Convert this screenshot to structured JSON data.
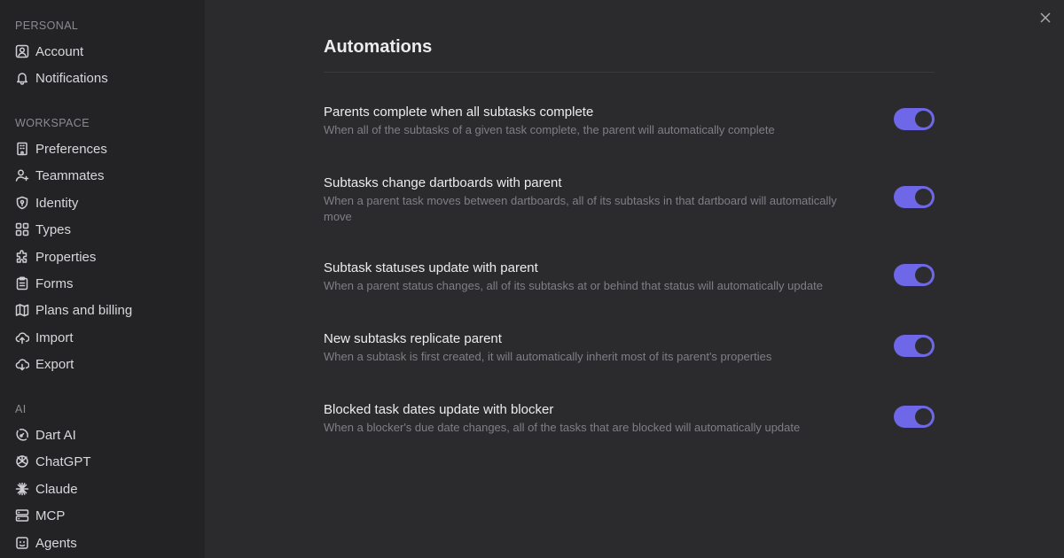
{
  "sidebar": {
    "sections": [
      {
        "title": "PERSONAL",
        "items": [
          {
            "label": "Account",
            "icon": "user-square-icon"
          },
          {
            "label": "Notifications",
            "icon": "bell-icon"
          }
        ]
      },
      {
        "title": "WORKSPACE",
        "items": [
          {
            "label": "Preferences",
            "icon": "building-icon"
          },
          {
            "label": "Teammates",
            "icon": "user-plus-icon"
          },
          {
            "label": "Identity",
            "icon": "shield-icon"
          },
          {
            "label": "Types",
            "icon": "grid-icon"
          },
          {
            "label": "Properties",
            "icon": "puzzle-icon"
          },
          {
            "label": "Forms",
            "icon": "clipboard-icon"
          },
          {
            "label": "Plans and billing",
            "icon": "map-icon"
          },
          {
            "label": "Import",
            "icon": "cloud-upload-icon"
          },
          {
            "label": "Export",
            "icon": "cloud-download-icon"
          }
        ]
      },
      {
        "title": "AI",
        "items": [
          {
            "label": "Dart AI",
            "icon": "dart-icon"
          },
          {
            "label": "ChatGPT",
            "icon": "openai-icon"
          },
          {
            "label": "Claude",
            "icon": "claude-icon"
          },
          {
            "label": "MCP",
            "icon": "server-icon"
          },
          {
            "label": "Agents",
            "icon": "agent-icon"
          }
        ]
      }
    ]
  },
  "main": {
    "title": "Automations",
    "settings": [
      {
        "label": "Parents complete when all subtasks complete",
        "description": "When all of the subtasks of a given task complete, the parent will automatically complete",
        "enabled": true
      },
      {
        "label": "Subtasks change dartboards with parent",
        "description": "When a parent task moves between dartboards, all of its subtasks in that dartboard will automatically move",
        "enabled": true
      },
      {
        "label": "Subtask statuses update with parent",
        "description": "When a parent status changes, all of its subtasks at or behind that status will automatically update",
        "enabled": true
      },
      {
        "label": "New subtasks replicate parent",
        "description": "When a subtask is first created, it will automatically inherit most of its parent's properties",
        "enabled": true
      },
      {
        "label": "Blocked task dates update with blocker",
        "description": "When a blocker's due date changes, all of the tasks that are blocked will automatically update",
        "enabled": true
      }
    ]
  },
  "colors": {
    "accent": "#6e67e8",
    "sidebar_bg": "#232325",
    "main_bg": "#2b2b2d"
  }
}
